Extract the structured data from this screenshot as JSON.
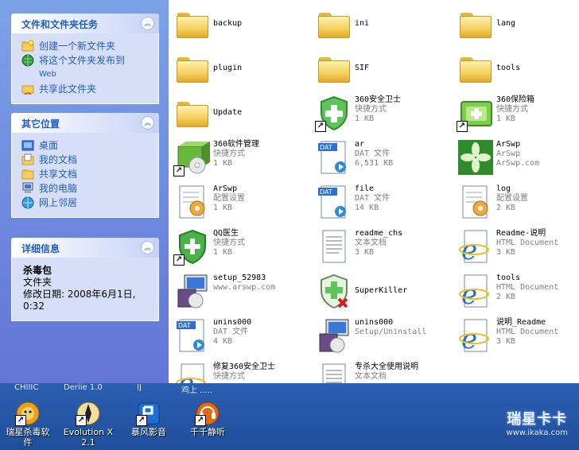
{
  "panels": {
    "tasks": {
      "title": "文件和文件夹任务",
      "items": [
        {
          "label": "创建一个新文件夹",
          "icon": "new-folder-icon"
        },
        {
          "label": "将这个文件夹发布到",
          "label2": "Web",
          "icon": "publish-web-icon"
        },
        {
          "label": "共享此文件夹",
          "icon": "share-folder-icon"
        }
      ]
    },
    "places": {
      "title": "其它位置",
      "items": [
        {
          "label": "桌面",
          "icon": "desktop-icon"
        },
        {
          "label": "我的文档",
          "icon": "my-documents-icon"
        },
        {
          "label": "共享文档",
          "icon": "shared-documents-icon"
        },
        {
          "label": "我的电脑",
          "icon": "my-computer-icon"
        },
        {
          "label": "网上邻居",
          "icon": "network-icon"
        }
      ]
    },
    "details": {
      "title": "详细信息",
      "name": "杀毒包",
      "type": "文件夹",
      "modified_line1": "修改日期: 2008年6月1日,",
      "modified_line2": "0:32"
    }
  },
  "files": [
    {
      "name": "backup",
      "icon": "folder-icon"
    },
    {
      "name": "ini",
      "icon": "folder-icon"
    },
    {
      "name": "lang",
      "icon": "folder-icon"
    },
    {
      "name": "plugin",
      "icon": "folder-icon"
    },
    {
      "name": "SIF",
      "icon": "folder-icon"
    },
    {
      "name": "tools",
      "icon": "folder-icon"
    },
    {
      "name": "Update",
      "icon": "folder-icon"
    },
    {
      "name": "360安全卫士",
      "line2": "快捷方式",
      "line3": "1 KB",
      "icon": "shield-plus-icon",
      "shortcut": true
    },
    {
      "name": "360保险箱",
      "line2": "快捷方式",
      "line3": "1 KB",
      "icon": "safe-box-icon",
      "shortcut": true
    },
    {
      "name": "360软件管理",
      "line2": "快捷方式",
      "line3": "1 KB",
      "icon": "software-box-icon",
      "shortcut": true
    },
    {
      "name": "ar",
      "line2": "DAT 文件",
      "line3": "6,531 KB",
      "icon": "dat-file-icon"
    },
    {
      "name": "ArSwp",
      "line2": "ArSwp",
      "line3": "ArSwp.com",
      "icon": "arswp-leaf-icon"
    },
    {
      "name": "ArSwp",
      "line2": "配置设置",
      "line3": "1 KB",
      "icon": "config-gear-icon"
    },
    {
      "name": "file",
      "line2": "DAT 文件",
      "line3": "14 KB",
      "icon": "dat-file-icon"
    },
    {
      "name": "log",
      "line2": "配置设置",
      "line3": "2 KB",
      "icon": "config-gear-icon"
    },
    {
      "name": "QQ医生",
      "line2": "快捷方式",
      "line3": "1 KB",
      "icon": "qq-doctor-icon",
      "shortcut": true
    },
    {
      "name": "readme_chs",
      "line2": "文本文档",
      "line3": "3 KB",
      "icon": "text-doc-icon"
    },
    {
      "name": "Readme-说明",
      "line2": "HTML Document",
      "line3": "3 KB",
      "icon": "ie-html-icon"
    },
    {
      "name": "setup_52983",
      "line2": "www.arswp.com",
      "icon": "installer-icon"
    },
    {
      "name": "SuperKiller",
      "icon": "superkiller-icon"
    },
    {
      "name": "tools",
      "line2": "HTML Document",
      "line3": "2 KB",
      "icon": "ie-html-icon"
    },
    {
      "name": "unins000",
      "line2": "DAT 文件",
      "line3": "4 KB",
      "icon": "dat-file-icon"
    },
    {
      "name": "unins000",
      "line2": "Setup/Uninstall",
      "icon": "installer-icon"
    },
    {
      "name": "说明_Readme",
      "line2": "HTML Document",
      "line3": "3 KB",
      "icon": "ie-html-icon"
    },
    {
      "name": "修复360安全卫士",
      "line2": "快捷方式",
      "icon": "ie-html-icon"
    },
    {
      "name": "专杀大全使用说明",
      "line2": "文本文档",
      "icon": "text-doc-icon"
    }
  ],
  "desktop": {
    "fragments": [
      "CHIIIC",
      "Deriie 1.0",
      "IJ",
      "鸡上 ....."
    ],
    "icons": [
      {
        "label": "瑞星杀毒软",
        "label2": "件",
        "icon": "rising-lion-icon"
      },
      {
        "label": "Evolution X",
        "label2": "2.1",
        "icon": "evolution-icon"
      },
      {
        "label": "暴风影音",
        "icon": "storm-player-icon"
      },
      {
        "label": "千千静听",
        "icon": "ttplayer-icon"
      }
    ],
    "brand": {
      "name": "瑞星卡卡",
      "url": "www.ikaka.com"
    }
  },
  "colors": {
    "link": "#215dc6",
    "taskpane_top": "#7ba2e7",
    "taskpane_bottom": "#6375d6",
    "desktop": "#2b5fb1"
  }
}
